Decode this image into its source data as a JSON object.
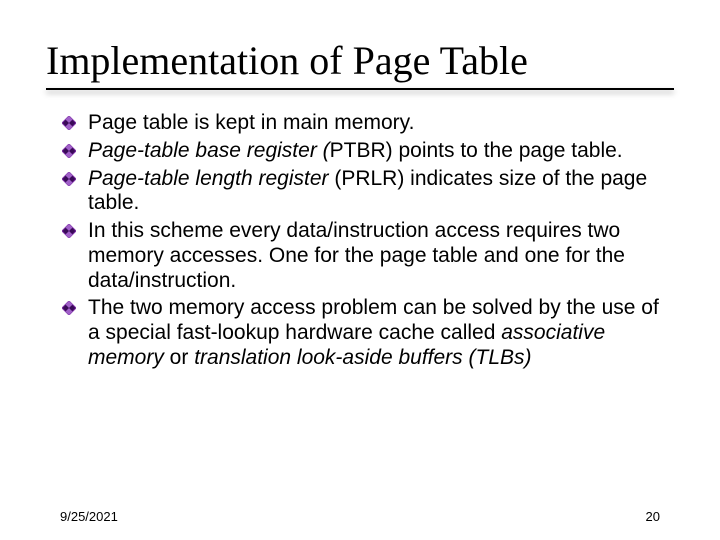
{
  "title": "Implementation of Page Table",
  "bullets": [
    {
      "segments": [
        {
          "text": "Page table is kept in main memory.",
          "italic": false
        }
      ]
    },
    {
      "segments": [
        {
          "text": "Page-table base register (",
          "italic": true
        },
        {
          "text": "PTBR) points to the page table.",
          "italic": false
        }
      ]
    },
    {
      "segments": [
        {
          "text": "Page-table length register",
          "italic": true
        },
        {
          "text": " (PRLR) indicates size of the page table.",
          "italic": false
        }
      ]
    },
    {
      "segments": [
        {
          "text": "In this scheme every data/instruction access requires two memory accesses.  One for the page table and one for the data/instruction.",
          "italic": false
        }
      ]
    },
    {
      "segments": [
        {
          "text": "The two memory access problem can be solved by the use of a special fast-lookup hardware cache called ",
          "italic": false
        },
        {
          "text": "associative memory",
          "italic": true
        },
        {
          "text": " or ",
          "italic": false
        },
        {
          "text": "translation look-aside buffers (TLBs)",
          "italic": true
        }
      ]
    }
  ],
  "footer": {
    "date": "9/25/2021",
    "page": "20"
  },
  "colors": {
    "bullet_border": "#7a2aa3",
    "bullet_fill_dark": "#3a0a58",
    "bullet_fill_light": "#a060c8"
  }
}
